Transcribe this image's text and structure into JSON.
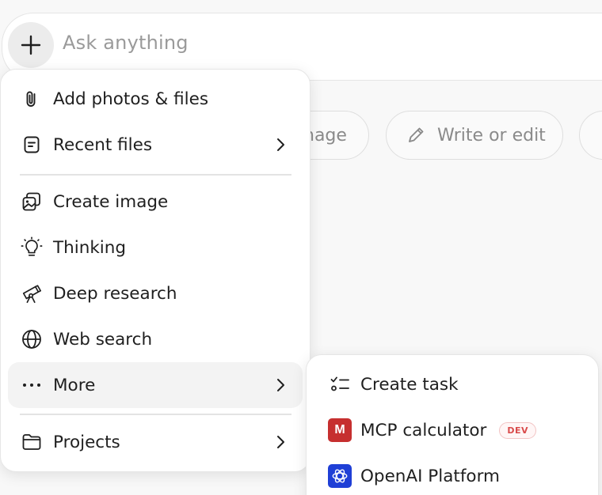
{
  "composer": {
    "placeholder": "Ask anything"
  },
  "chips": [
    {
      "label": "nage",
      "icon": "image-icon"
    },
    {
      "label": "Write or edit",
      "icon": "pencil-icon"
    }
  ],
  "menu": {
    "items": [
      {
        "label": "Add photos & files",
        "icon": "paperclip-icon"
      },
      {
        "label": "Recent files",
        "icon": "file-icon",
        "has_submenu": true
      },
      {
        "label": "Create image",
        "icon": "image-icon"
      },
      {
        "label": "Thinking",
        "icon": "lightbulb-icon"
      },
      {
        "label": "Deep research",
        "icon": "telescope-icon"
      },
      {
        "label": "Web search",
        "icon": "globe-icon"
      },
      {
        "label": "More",
        "icon": "ellipsis-icon",
        "has_submenu": true,
        "highlighted": true
      },
      {
        "label": "Projects",
        "icon": "folder-icon",
        "has_submenu": true
      }
    ]
  },
  "submenu": {
    "items": [
      {
        "label": "Create task",
        "icon": "checklist-icon"
      },
      {
        "label": "MCP calculator",
        "icon": "app-tile-m",
        "tile_letter": "M",
        "tile_color": "#c62f2f",
        "badge": "DEV"
      },
      {
        "label": "OpenAI Platform",
        "icon": "openai-icon",
        "tile_color": "#1f3fd6"
      }
    ]
  },
  "colors": {
    "background": "#f8f8f8",
    "menu_background": "#ffffff",
    "hover_background": "#f3f3f3",
    "badge_text": "#d94b4b"
  }
}
